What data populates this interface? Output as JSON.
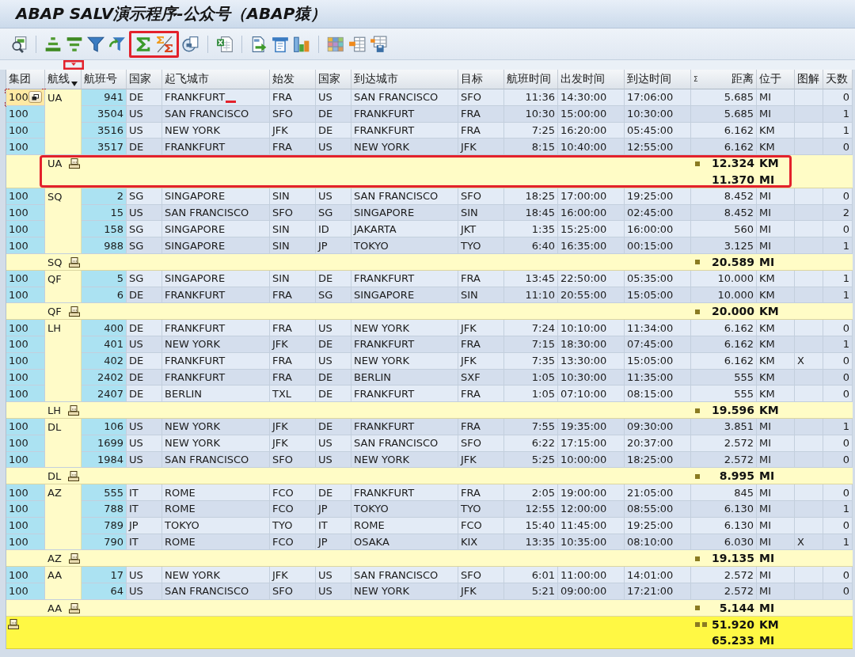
{
  "window": {
    "title": "ABAP SALV演示程序-公众号（ABAP猿）"
  },
  "toolbar": {
    "groups": [
      {
        "buttons": [
          {
            "kind": "details",
            "highlighted": false
          }
        ]
      },
      {
        "buttons": [
          {
            "kind": "sort_ascending",
            "highlighted": false
          },
          {
            "kind": "sort_descending",
            "highlighted": false
          },
          {
            "kind": "filter",
            "highlighted": false
          },
          {
            "kind": "filter_undo",
            "highlighted": false
          },
          {
            "kind": "sum",
            "highlighted": true
          },
          {
            "kind": "subtotal",
            "highlighted": true
          },
          {
            "kind": "view",
            "highlighted": false
          }
        ]
      },
      {
        "buttons": [
          {
            "kind": "excel",
            "highlighted": false
          }
        ]
      },
      {
        "buttons": [
          {
            "kind": "export",
            "highlighted": false
          },
          {
            "kind": "word",
            "highlighted": false
          },
          {
            "kind": "chart",
            "highlighted": false
          }
        ]
      },
      {
        "buttons": [
          {
            "kind": "layout",
            "highlighted": false
          },
          {
            "kind": "layout_select",
            "highlighted": false
          },
          {
            "kind": "layout_save",
            "highlighted": false
          }
        ]
      }
    ]
  },
  "table": {
    "columns": [
      {
        "label": "集团",
        "sorted": false,
        "highlighted": false
      },
      {
        "label": "航线",
        "sorted": true,
        "highlighted": true
      },
      {
        "label": "航班号",
        "sorted": false,
        "highlighted": false
      },
      {
        "label": "国家",
        "sorted": false,
        "highlighted": false
      },
      {
        "label": "起飞城市",
        "sorted": false,
        "highlighted": false
      },
      {
        "label": "始发",
        "sorted": false,
        "highlighted": false
      },
      {
        "label": "国家",
        "sorted": false,
        "highlighted": false
      },
      {
        "label": "到达城市",
        "sorted": false,
        "highlighted": false
      },
      {
        "label": "目标",
        "sorted": false,
        "highlighted": false
      },
      {
        "label": "航班时间",
        "sorted": false,
        "highlighted": false
      },
      {
        "label": "出发时间",
        "sorted": false,
        "highlighted": false
      },
      {
        "label": "到达时间",
        "sorted": false,
        "highlighted": false
      },
      {
        "label": "距离",
        "sign": "Σ",
        "sorted": false,
        "highlighted": false
      },
      {
        "label": "位于",
        "sorted": false,
        "highlighted": false
      },
      {
        "label": "图解",
        "sorted": false,
        "highlighted": false
      },
      {
        "label": "天数",
        "sorted": false,
        "highlighted": false
      }
    ],
    "groups": [
      {
        "carrier": "UA",
        "rows": [
          {
            "client": "100",
            "flight_no": "941",
            "country_from": "DE",
            "city_from": "FRANKFURT",
            "airport_from": "FRA",
            "country_to": "US",
            "city_to": "SAN FRANCISCO",
            "airport_to": "SFO",
            "flight_time": "11:36",
            "departure": "14:30:00",
            "arrival": "17:06:00",
            "distance": "5.685",
            "unit": "MI",
            "days": "0",
            "focused": true,
            "marked": true
          },
          {
            "client": "100",
            "flight_no": "3504",
            "country_from": "US",
            "city_from": "SAN FRANCISCO",
            "airport_from": "SFO",
            "country_to": "DE",
            "city_to": "FRANKFURT",
            "airport_to": "FRA",
            "flight_time": "10:30",
            "departure": "15:00:00",
            "arrival": "10:30:00",
            "distance": "5.685",
            "unit": "MI",
            "days": "1",
            "focused": false,
            "marked": false
          },
          {
            "client": "100",
            "flight_no": "3516",
            "country_from": "US",
            "city_from": "NEW YORK",
            "airport_from": "JFK",
            "country_to": "DE",
            "city_to": "FRANKFURT",
            "airport_to": "FRA",
            "flight_time": "7:25",
            "departure": "16:20:00",
            "arrival": "05:45:00",
            "distance": "6.162",
            "unit": "KM",
            "days": "1",
            "focused": false,
            "marked": false
          },
          {
            "client": "100",
            "flight_no": "3517",
            "country_from": "DE",
            "city_from": "FRANKFURT",
            "airport_from": "FRA",
            "country_to": "US",
            "city_to": "NEW YORK",
            "airport_to": "JFK",
            "flight_time": "8:15",
            "departure": "10:40:00",
            "arrival": "12:55:00",
            "distance": "6.162",
            "unit": "KM",
            "days": "0",
            "focused": false,
            "marked": false
          }
        ],
        "subtotal": {
          "label": "UA",
          "highlighted": true,
          "totals": [
            {
              "distance": "12.324",
              "unit": "KM"
            },
            {
              "distance": "11.370",
              "unit": "MI"
            }
          ]
        }
      },
      {
        "carrier": "SQ",
        "rows": [
          {
            "client": "100",
            "flight_no": "2",
            "country_from": "SG",
            "city_from": "SINGAPORE",
            "airport_from": "SIN",
            "country_to": "US",
            "city_to": "SAN FRANCISCO",
            "airport_to": "SFO",
            "flight_time": "18:25",
            "departure": "17:00:00",
            "arrival": "19:25:00",
            "distance": "8.452",
            "unit": "MI",
            "days": "0",
            "focused": false,
            "marked": false
          },
          {
            "client": "100",
            "flight_no": "15",
            "country_from": "US",
            "city_from": "SAN FRANCISCO",
            "airport_from": "SFO",
            "country_to": "SG",
            "city_to": "SINGAPORE",
            "airport_to": "SIN",
            "flight_time": "18:45",
            "departure": "16:00:00",
            "arrival": "02:45:00",
            "distance": "8.452",
            "unit": "MI",
            "days": "2",
            "focused": false,
            "marked": false
          },
          {
            "client": "100",
            "flight_no": "158",
            "country_from": "SG",
            "city_from": "SINGAPORE",
            "airport_from": "SIN",
            "country_to": "ID",
            "city_to": "JAKARTA",
            "airport_to": "JKT",
            "flight_time": "1:35",
            "departure": "15:25:00",
            "arrival": "16:00:00",
            "distance": "560",
            "unit": "MI",
            "days": "0",
            "focused": false,
            "marked": false
          },
          {
            "client": "100",
            "flight_no": "988",
            "country_from": "SG",
            "city_from": "SINGAPORE",
            "airport_from": "SIN",
            "country_to": "JP",
            "city_to": "TOKYO",
            "airport_to": "TYO",
            "flight_time": "6:40",
            "departure": "16:35:00",
            "arrival": "00:15:00",
            "distance": "3.125",
            "unit": "MI",
            "days": "1",
            "focused": false,
            "marked": false
          }
        ],
        "subtotal": {
          "label": "SQ",
          "highlighted": false,
          "totals": [
            {
              "distance": "20.589",
              "unit": "MI"
            }
          ]
        }
      },
      {
        "carrier": "QF",
        "rows": [
          {
            "client": "100",
            "flight_no": "5",
            "country_from": "SG",
            "city_from": "SINGAPORE",
            "airport_from": "SIN",
            "country_to": "DE",
            "city_to": "FRANKFURT",
            "airport_to": "FRA",
            "flight_time": "13:45",
            "departure": "22:50:00",
            "arrival": "05:35:00",
            "distance": "10.000",
            "unit": "KM",
            "days": "1",
            "focused": false,
            "marked": false
          },
          {
            "client": "100",
            "flight_no": "6",
            "country_from": "DE",
            "city_from": "FRANKFURT",
            "airport_from": "FRA",
            "country_to": "SG",
            "city_to": "SINGAPORE",
            "airport_to": "SIN",
            "flight_time": "11:10",
            "departure": "20:55:00",
            "arrival": "15:05:00",
            "distance": "10.000",
            "unit": "KM",
            "days": "1",
            "focused": false,
            "marked": false
          }
        ],
        "subtotal": {
          "label": "QF",
          "highlighted": false,
          "totals": [
            {
              "distance": "20.000",
              "unit": "KM"
            }
          ]
        }
      },
      {
        "carrier": "LH",
        "rows": [
          {
            "client": "100",
            "flight_no": "400",
            "country_from": "DE",
            "city_from": "FRANKFURT",
            "airport_from": "FRA",
            "country_to": "US",
            "city_to": "NEW YORK",
            "airport_to": "JFK",
            "flight_time": "7:24",
            "departure": "10:10:00",
            "arrival": "11:34:00",
            "distance": "6.162",
            "unit": "KM",
            "days": "0",
            "focused": false,
            "marked": false
          },
          {
            "client": "100",
            "flight_no": "401",
            "country_from": "US",
            "city_from": "NEW YORK",
            "airport_from": "JFK",
            "country_to": "DE",
            "city_to": "FRANKFURT",
            "airport_to": "FRA",
            "flight_time": "7:15",
            "departure": "18:30:00",
            "arrival": "07:45:00",
            "distance": "6.162",
            "unit": "KM",
            "days": "1",
            "focused": false,
            "marked": false
          },
          {
            "client": "100",
            "flight_no": "402",
            "country_from": "DE",
            "city_from": "FRANKFURT",
            "airport_from": "FRA",
            "country_to": "US",
            "city_to": "NEW YORK",
            "airport_to": "JFK",
            "flight_time": "7:35",
            "departure": "13:30:00",
            "arrival": "15:05:00",
            "distance": "6.162",
            "unit": "KM",
            "flight_type": "X",
            "days": "0",
            "focused": false,
            "marked": false
          },
          {
            "client": "100",
            "flight_no": "2402",
            "country_from": "DE",
            "city_from": "FRANKFURT",
            "airport_from": "FRA",
            "country_to": "DE",
            "city_to": "BERLIN",
            "airport_to": "SXF",
            "flight_time": "1:05",
            "departure": "10:30:00",
            "arrival": "11:35:00",
            "distance": "555",
            "unit": "KM",
            "days": "0",
            "focused": false,
            "marked": false
          },
          {
            "client": "100",
            "flight_no": "2407",
            "country_from": "DE",
            "city_from": "BERLIN",
            "airport_from": "TXL",
            "country_to": "DE",
            "city_to": "FRANKFURT",
            "airport_to": "FRA",
            "flight_time": "1:05",
            "departure": "07:10:00",
            "arrival": "08:15:00",
            "distance": "555",
            "unit": "KM",
            "days": "0",
            "focused": false,
            "marked": false
          }
        ],
        "subtotal": {
          "label": "LH",
          "highlighted": false,
          "totals": [
            {
              "distance": "19.596",
              "unit": "KM"
            }
          ]
        }
      },
      {
        "carrier": "DL",
        "rows": [
          {
            "client": "100",
            "flight_no": "106",
            "country_from": "US",
            "city_from": "NEW YORK",
            "airport_from": "JFK",
            "country_to": "DE",
            "city_to": "FRANKFURT",
            "airport_to": "FRA",
            "flight_time": "7:55",
            "departure": "19:35:00",
            "arrival": "09:30:00",
            "distance": "3.851",
            "unit": "MI",
            "days": "1",
            "focused": false,
            "marked": false
          },
          {
            "client": "100",
            "flight_no": "1699",
            "country_from": "US",
            "city_from": "NEW YORK",
            "airport_from": "JFK",
            "country_to": "US",
            "city_to": "SAN FRANCISCO",
            "airport_to": "SFO",
            "flight_time": "6:22",
            "departure": "17:15:00",
            "arrival": "20:37:00",
            "distance": "2.572",
            "unit": "MI",
            "days": "0",
            "focused": false,
            "marked": false
          },
          {
            "client": "100",
            "flight_no": "1984",
            "country_from": "US",
            "city_from": "SAN FRANCISCO",
            "airport_from": "SFO",
            "country_to": "US",
            "city_to": "NEW YORK",
            "airport_to": "JFK",
            "flight_time": "5:25",
            "departure": "10:00:00",
            "arrival": "18:25:00",
            "distance": "2.572",
            "unit": "MI",
            "days": "0",
            "focused": false,
            "marked": false
          }
        ],
        "subtotal": {
          "label": "DL",
          "highlighted": false,
          "totals": [
            {
              "distance": "8.995",
              "unit": "MI"
            }
          ]
        }
      },
      {
        "carrier": "AZ",
        "rows": [
          {
            "client": "100",
            "flight_no": "555",
            "country_from": "IT",
            "city_from": "ROME",
            "airport_from": "FCO",
            "country_to": "DE",
            "city_to": "FRANKFURT",
            "airport_to": "FRA",
            "flight_time": "2:05",
            "departure": "19:00:00",
            "arrival": "21:05:00",
            "distance": "845",
            "unit": "MI",
            "days": "0",
            "focused": false,
            "marked": false
          },
          {
            "client": "100",
            "flight_no": "788",
            "country_from": "IT",
            "city_from": "ROME",
            "airport_from": "FCO",
            "country_to": "JP",
            "city_to": "TOKYO",
            "airport_to": "TYO",
            "flight_time": "12:55",
            "departure": "12:00:00",
            "arrival": "08:55:00",
            "distance": "6.130",
            "unit": "MI",
            "days": "1",
            "focused": false,
            "marked": false
          },
          {
            "client": "100",
            "flight_no": "789",
            "country_from": "JP",
            "city_from": "TOKYO",
            "airport_from": "TYO",
            "country_to": "IT",
            "city_to": "ROME",
            "airport_to": "FCO",
            "flight_time": "15:40",
            "departure": "11:45:00",
            "arrival": "19:25:00",
            "distance": "6.130",
            "unit": "MI",
            "days": "0",
            "focused": false,
            "marked": false
          },
          {
            "client": "100",
            "flight_no": "790",
            "country_from": "IT",
            "city_from": "ROME",
            "airport_from": "FCO",
            "country_to": "JP",
            "city_to": "OSAKA",
            "airport_to": "KIX",
            "flight_time": "13:35",
            "departure": "10:35:00",
            "arrival": "08:10:00",
            "distance": "6.030",
            "unit": "MI",
            "flight_type": "X",
            "days": "1",
            "focused": false,
            "marked": false
          }
        ],
        "subtotal": {
          "label": "AZ",
          "highlighted": false,
          "totals": [
            {
              "distance": "19.135",
              "unit": "MI"
            }
          ]
        }
      },
      {
        "carrier": "AA",
        "rows": [
          {
            "client": "100",
            "flight_no": "17",
            "country_from": "US",
            "city_from": "NEW YORK",
            "airport_from": "JFK",
            "country_to": "US",
            "city_to": "SAN FRANCISCO",
            "airport_to": "SFO",
            "flight_time": "6:01",
            "departure": "11:00:00",
            "arrival": "14:01:00",
            "distance": "2.572",
            "unit": "MI",
            "days": "0",
            "focused": false,
            "marked": false
          },
          {
            "client": "100",
            "flight_no": "64",
            "country_from": "US",
            "city_from": "SAN FRANCISCO",
            "airport_from": "SFO",
            "country_to": "US",
            "city_to": "NEW YORK",
            "airport_to": "JFK",
            "flight_time": "5:21",
            "departure": "09:00:00",
            "arrival": "17:21:00",
            "distance": "2.572",
            "unit": "MI",
            "days": "0",
            "focused": false,
            "marked": false
          }
        ],
        "subtotal": {
          "label": "AA",
          "highlighted": false,
          "totals": [
            {
              "distance": "5.144",
              "unit": "MI"
            }
          ]
        }
      }
    ],
    "grand_total": {
      "totals": [
        {
          "distance": "51.920",
          "unit": "KM"
        },
        {
          "distance": "65.233",
          "unit": "MI"
        }
      ]
    }
  }
}
